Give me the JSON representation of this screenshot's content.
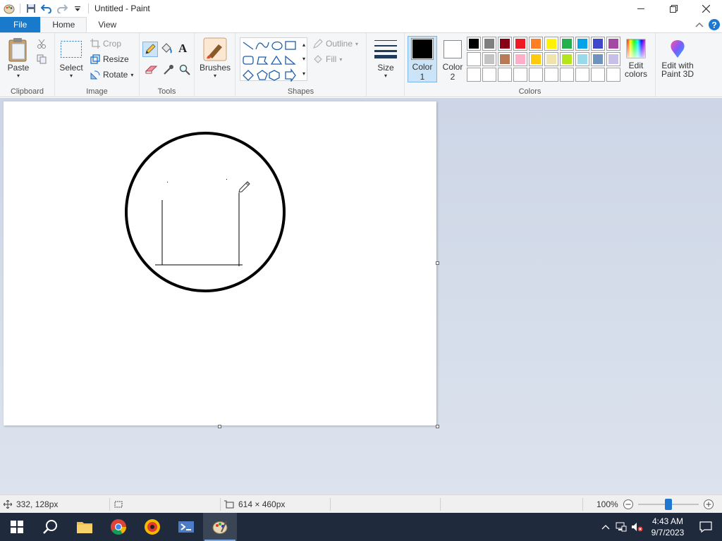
{
  "window": {
    "title": "Untitled - Paint"
  },
  "tabs": [
    {
      "label": "File"
    },
    {
      "label": "Home"
    },
    {
      "label": "View"
    }
  ],
  "ribbon": {
    "clipboard": {
      "label": "Clipboard",
      "paste": "Paste"
    },
    "image": {
      "label": "Image",
      "select": "Select",
      "crop": "Crop",
      "resize": "Resize",
      "rotate": "Rotate"
    },
    "tools": {
      "label": "Tools"
    },
    "brushes": {
      "label": "Brushes"
    },
    "shapes": {
      "label": "Shapes",
      "outline": "Outline",
      "fill": "Fill"
    },
    "size": {
      "label": "Size"
    },
    "colors": {
      "label": "Colors",
      "color1_label": "Color\n1",
      "color1_line1": "Color",
      "color1_line2": "1",
      "color2_line1": "Color",
      "color2_line2": "2",
      "color1": "#000000",
      "color2": "#ffffff",
      "edit_line1": "Edit",
      "edit_line2": "colors",
      "paint3d_line1": "Edit with",
      "paint3d_line2": "Paint 3D",
      "palette_row1": [
        "#000000",
        "#7f7f7f",
        "#880015",
        "#ed1c24",
        "#ff7f27",
        "#fff200",
        "#22b14c",
        "#00a2e8",
        "#3f48cc",
        "#a349a4"
      ],
      "palette_row2": [
        "#ffffff",
        "#c3c3c3",
        "#b97a57",
        "#ffaec9",
        "#ffc90e",
        "#efe4b0",
        "#b5e61d",
        "#99d9ea",
        "#7092be",
        "#c8bfe7"
      ],
      "palette_row3": [
        "#ffffff",
        "#ffffff",
        "#ffffff",
        "#ffffff",
        "#ffffff",
        "#ffffff",
        "#ffffff",
        "#ffffff",
        "#ffffff",
        "#ffffff"
      ]
    }
  },
  "status": {
    "cursor_pos": "332, 128px",
    "image_size": "614 × 460px",
    "zoom": "100%",
    "zoom_level": 0.5
  },
  "taskbar": {
    "time": "4:43 AM",
    "date": "9/7/2023"
  }
}
